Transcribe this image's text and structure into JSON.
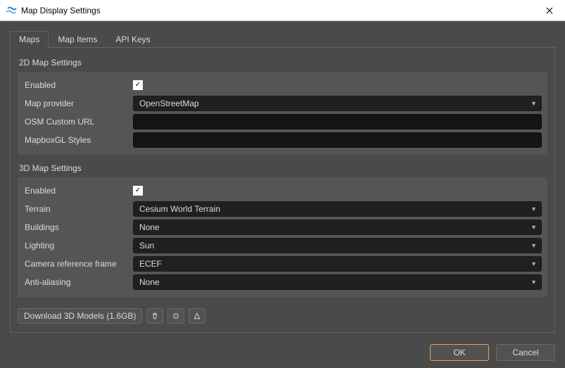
{
  "window": {
    "title": "Map Display Settings"
  },
  "tabs": {
    "maps": "Maps",
    "map_items": "Map Items",
    "api_keys": "API Keys"
  },
  "sections": {
    "s2d": {
      "title": "2D Map Settings",
      "enabled_label": "Enabled",
      "enabled_checked": true,
      "map_provider_label": "Map provider",
      "map_provider_value": "OpenStreetMap",
      "osm_url_label": "OSM Custom URL",
      "osm_url_value": "",
      "mapbox_label": "MapboxGL Styles",
      "mapbox_value": ""
    },
    "s3d": {
      "title": "3D Map Settings",
      "enabled_label": "Enabled",
      "enabled_checked": true,
      "terrain_label": "Terrain",
      "terrain_value": "Cesium World Terrain",
      "buildings_label": "Buildings",
      "buildings_value": "None",
      "lighting_label": "Lighting",
      "lighting_value": "Sun",
      "cam_label": "Camera reference frame",
      "cam_value": "ECEF",
      "aa_label": "Anti-aliasing",
      "aa_value": "None"
    }
  },
  "buttons": {
    "download": "Download 3D Models (1.6GB)",
    "ok": "OK",
    "cancel": "Cancel"
  }
}
